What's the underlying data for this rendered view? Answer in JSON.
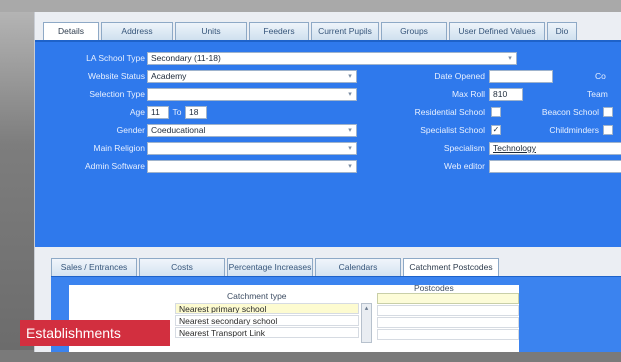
{
  "tabs": [
    "Details",
    "Address",
    "Units",
    "Feeders",
    "Current Pupils",
    "Groups",
    "User Defined Values",
    "Dio"
  ],
  "details": {
    "la_school_type": {
      "label": "LA School Type",
      "value": "Secondary (11-18)"
    },
    "website_status": {
      "label": "Website Status",
      "value": "Academy"
    },
    "selection_type": {
      "label": "Selection Type",
      "value": ""
    },
    "age": {
      "label": "Age",
      "from": "11",
      "to_label": "To",
      "to": "18"
    },
    "gender": {
      "label": "Gender",
      "value": "Coeducational"
    },
    "main_religion": {
      "label": "Main Religion",
      "value": ""
    },
    "admin_software": {
      "label": "Admin Software",
      "value": ""
    },
    "date_opened": {
      "label": "Date Opened",
      "value": ""
    },
    "max_roll": {
      "label": "Max Roll",
      "value": "810"
    },
    "residential_school": {
      "label": "Residential School"
    },
    "special_school": {
      "label": "Specialist School",
      "checked": "✓"
    },
    "specialism": {
      "label": "Specialism",
      "value": "Technology"
    },
    "web_editor": {
      "label": "Web editor",
      "value": ""
    },
    "cut_labels": {
      "co": "Co",
      "team": "Team",
      "beacon": "Beacon School",
      "childminders": "Childminders"
    }
  },
  "lower_tabs": [
    "Sales / Entrances",
    "Costs",
    "Percentage Increases",
    "Calendars",
    "Catchment Postcodes"
  ],
  "catchment": {
    "type_header": "Catchment type",
    "postcodes_header": "Postcodes",
    "rows": [
      "Nearest primary school",
      "Nearest secondary school",
      "Nearest Transport Link"
    ]
  },
  "banner": "Establishments"
}
